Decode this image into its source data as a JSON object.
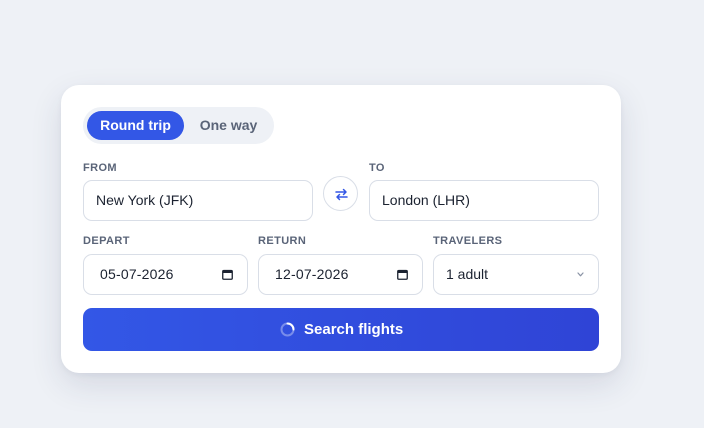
{
  "trip_type": {
    "options": [
      "Round trip",
      "One way"
    ],
    "selected": "Round trip"
  },
  "from": {
    "label": "FROM",
    "value": "New York (JFK)"
  },
  "to": {
    "label": "TO",
    "value": "London (LHR)"
  },
  "depart": {
    "label": "DEPART",
    "value": "05-07-2026"
  },
  "return": {
    "label": "RETURN",
    "value": "12-07-2026"
  },
  "travelers": {
    "label": "TRAVELERS",
    "value": "1 adult"
  },
  "search_button": {
    "label": "Search flights",
    "state": "loading"
  },
  "icons": {
    "swap": "swap-arrows-icon",
    "calendar": "calendar-icon",
    "select": "chevron-down-icon",
    "spinner": "loading-spinner-icon"
  },
  "colors": {
    "accent": "#3357e6",
    "background": "#eef1f6",
    "card": "#ffffff",
    "label": "#5a6478"
  }
}
